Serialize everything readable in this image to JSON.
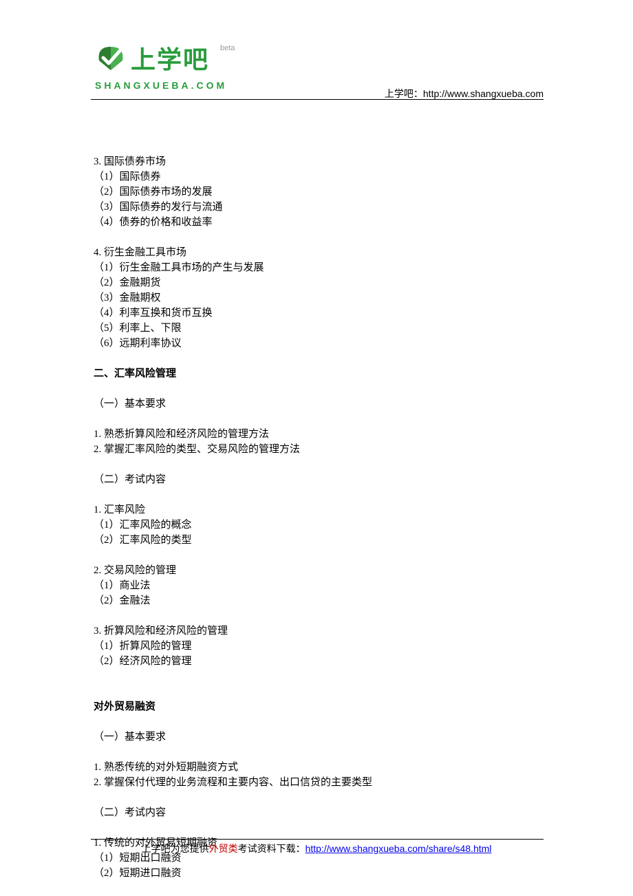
{
  "header": {
    "logo_text": "上学吧",
    "logo_beta": "beta",
    "logo_domain": "SHANGXUEBA.COM",
    "right_label": "上学吧：",
    "right_url": "http://www.shangxueba.com"
  },
  "sections": [
    {
      "type": "group",
      "lines": [
        "3. 国际债券市场",
        "（1）国际债券",
        "（2）国际债券市场的发展",
        "（3）国际债券的发行与流通",
        "（4）债券的价格和收益率"
      ]
    },
    {
      "type": "group",
      "lines": [
        "4. 衍生金融工具市场",
        "（1）衍生金融工具市场的产生与发展",
        "（2）金融期货",
        "（3）金融期权",
        "（4）利率互换和货币互换",
        "（5）利率上、下限",
        "（6）远期利率协议"
      ]
    },
    {
      "type": "heading",
      "text": "二、汇率风险管理"
    },
    {
      "type": "group",
      "lines": [
        "（一）基本要求"
      ]
    },
    {
      "type": "group",
      "lines": [
        "1. 熟悉折算风险和经济风险的管理方法",
        "2. 掌握汇率风险的类型、交易风险的管理方法"
      ]
    },
    {
      "type": "group",
      "lines": [
        "（二）考试内容"
      ]
    },
    {
      "type": "group",
      "lines": [
        "1. 汇率风险",
        "（1）汇率风险的概念",
        "（2）汇率风险的类型"
      ]
    },
    {
      "type": "group",
      "lines": [
        "2. 交易风险的管理",
        "（1）商业法",
        "（2）金融法"
      ]
    },
    {
      "type": "group",
      "lines": [
        "3. 折算风险和经济风险的管理",
        "（1）折算风险的管理",
        "（2）经济风险的管理"
      ]
    },
    {
      "type": "gap"
    },
    {
      "type": "heading",
      "text": "对外贸易融资"
    },
    {
      "type": "group",
      "lines": [
        "（一）基本要求"
      ]
    },
    {
      "type": "group",
      "lines": [
        "1. 熟悉传统的对外短期融资方式",
        "2. 掌握保付代理的业务流程和主要内容、出口信贷的主要类型"
      ]
    },
    {
      "type": "group",
      "lines": [
        "（二）考试内容"
      ]
    },
    {
      "type": "group",
      "lines": [
        "1. 传统的对外贸易短期融资",
        "（1）短期出口融资",
        "（2）短期进口融资"
      ]
    }
  ],
  "footer": {
    "prefix": "上学吧为您提供",
    "red_text": "外贸类",
    "suffix": "考试资料下载：",
    "url": "http://www.shangxueba.com/share/s48.html"
  }
}
